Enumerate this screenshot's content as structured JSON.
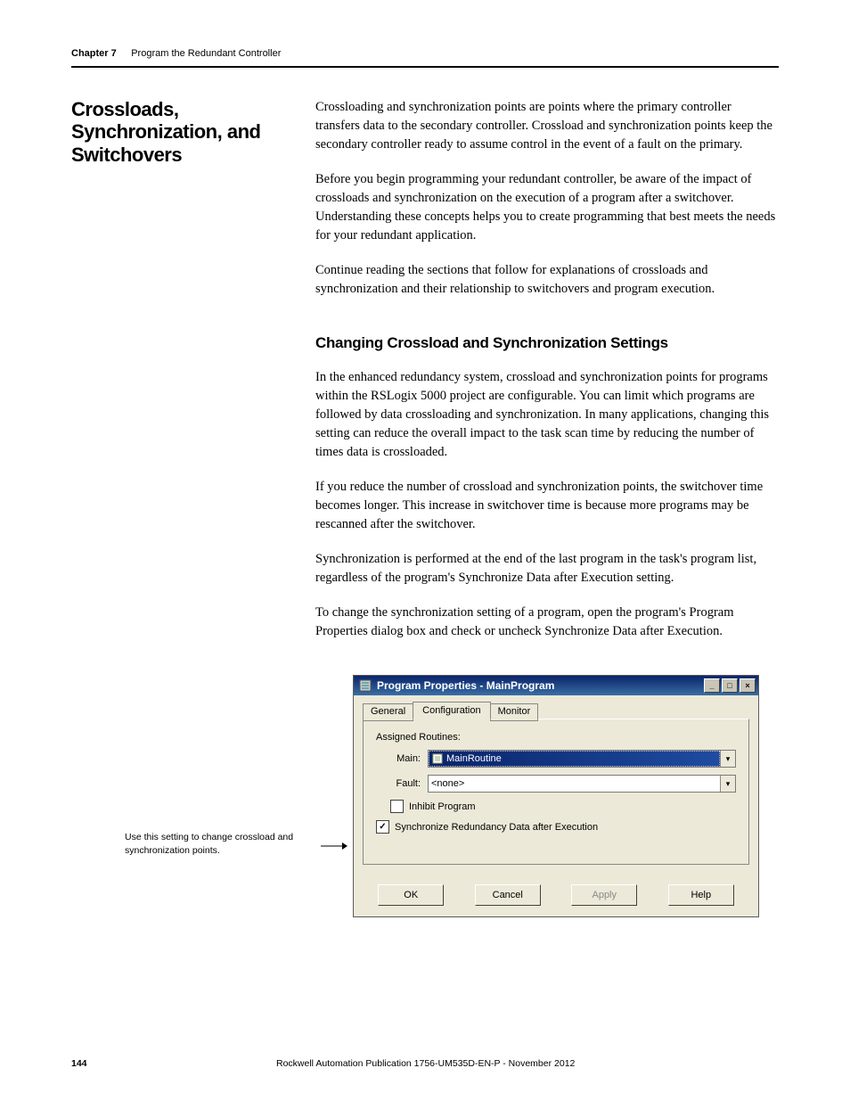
{
  "header": {
    "chapter": "Chapter 7",
    "title": "Program the Redundant Controller"
  },
  "section": {
    "title": "Crossloads, Synchronization, and Switchovers",
    "paragraphs": [
      "Crossloading and synchronization points are points where the primary controller transfers data to the secondary controller. Crossload and synchronization points keep the secondary controller ready to assume control in the event of a fault on the primary.",
      "Before you begin programming your redundant controller, be aware of the impact of crossloads and synchronization on the execution of a program after a switchover. Understanding these concepts helps you to create programming that best meets the needs for your redundant application.",
      "Continue reading the sections that follow for explanations of crossloads and synchronization and their relationship to switchovers and program execution."
    ]
  },
  "subsection": {
    "title": "Changing Crossload and Synchronization Settings",
    "paragraphs": [
      "In the enhanced redundancy system, crossload and synchronization points for programs within the RSLogix 5000 project are configurable. You can limit which programs are followed by data crossloading and synchronization. In many applications, changing this setting can reduce the overall impact to the task scan time by reducing the number of times data is crossloaded.",
      "If you reduce the number of crossload and synchronization points, the switchover time becomes longer. This increase in switchover time is because more programs may be rescanned after the switchover.",
      "Synchronization is performed at the end of the last program in the task's program list, regardless of the program's Synchronize Data after Execution setting.",
      "To change the synchronization setting of a program, open the program's Program Properties dialog box and check or uncheck Synchronize Data after Execution."
    ]
  },
  "callout": "Use this setting to change crossload and synchronization points.",
  "dialog": {
    "title": "Program Properties - MainProgram",
    "tabs": {
      "general": "General",
      "configuration": "Configuration",
      "monitor": "Monitor"
    },
    "assigned_label": "Assigned Routines:",
    "fields": {
      "main_label": "Main:",
      "main_value": "MainRoutine",
      "fault_label": "Fault:",
      "fault_value": "<none>"
    },
    "checkboxes": {
      "inhibit": "Inhibit Program",
      "sync": "Synchronize Redundancy Data after Execution"
    },
    "buttons": {
      "ok": "OK",
      "cancel": "Cancel",
      "apply": "Apply",
      "help": "Help"
    }
  },
  "footer": {
    "page": "144",
    "publication": "Rockwell Automation Publication 1756-UM535D-EN-P - November 2012"
  }
}
